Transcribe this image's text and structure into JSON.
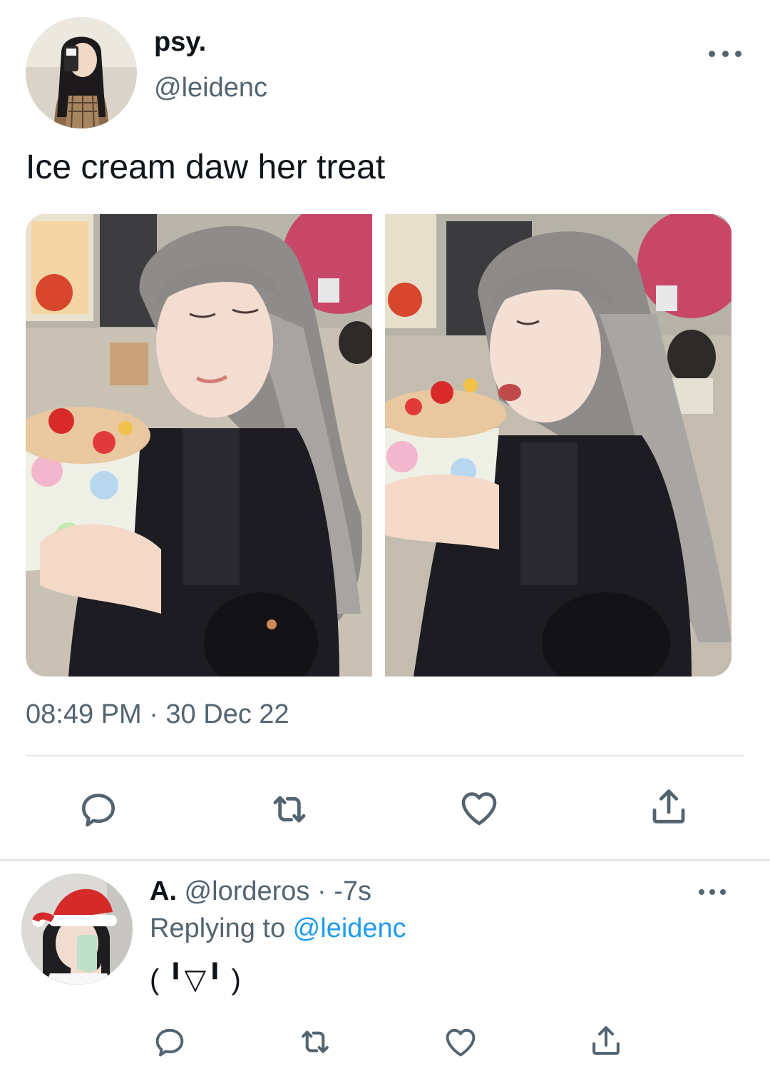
{
  "tweet": {
    "display_name": "psy.",
    "handle": "@leidenc",
    "text": "Ice cream daw her treat",
    "timestamp": "08:49 PM · 30 Dec 22",
    "actions": [
      "reply-icon",
      "retweet-icon",
      "like-icon",
      "share-icon"
    ]
  },
  "reply": {
    "display_name": "A.",
    "meta": " @lorderos · -7s",
    "replying_prefix": "Replying to ",
    "replying_handle": "@leidenc",
    "text": "( ╹▽╹ )",
    "actions": [
      "reply-icon",
      "retweet-icon",
      "like-icon",
      "share-icon"
    ]
  },
  "colors": {
    "text_primary": "#0f1419",
    "text_secondary": "#536471",
    "link": "#1d9bf0",
    "divider": "#e3e7ea"
  }
}
